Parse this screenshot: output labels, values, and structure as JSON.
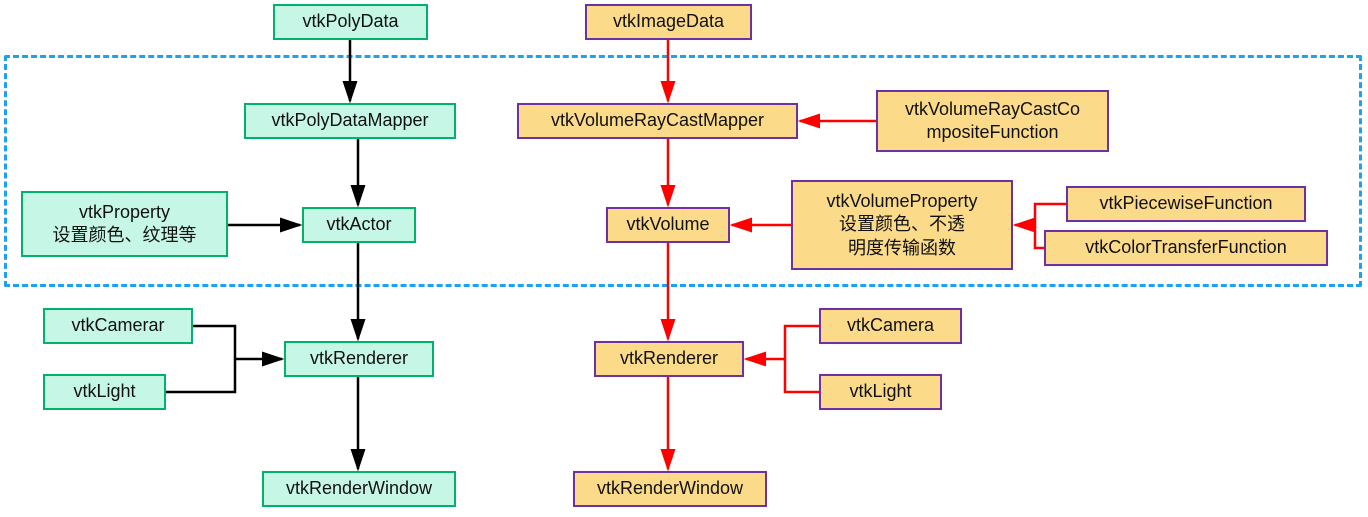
{
  "left": {
    "polyData": "vtkPolyData",
    "polyDataMapper": "vtkPolyDataMapper",
    "actor": "vtkActor",
    "property": "vtkProperty\n设置颜色、纹理等",
    "renderer": "vtkRenderer",
    "camera": "vtkCamerar",
    "light": "vtkLight",
    "renderWindow": "vtkRenderWindow"
  },
  "right": {
    "imageData": "vtkImageData",
    "rayCastMapper": "vtkVolumeRayCastMapper",
    "rayCastComposite": "vtkVolumeRayCastCo\nmpositeFunction",
    "volume": "vtkVolume",
    "volumeProperty": "vtkVolumeProperty\n设置颜色、不透\n明度传输函数",
    "piecewise": "vtkPiecewiseFunction",
    "colorTransfer": "vtkColorTransferFunction",
    "renderer": "vtkRenderer",
    "camera": "vtkCamera",
    "light": "vtkLight",
    "renderWindow": "vtkRenderWindow"
  },
  "colors": {
    "leftArrow": "#000000",
    "rightArrow": "#ff0000",
    "dashBorder": "#1da1f2",
    "leftBoxFill": "#c6f7e6",
    "leftBoxBorder": "#01b26c",
    "rightBoxFill": "#fbdb8a",
    "rightBoxBorder": "#7030a0"
  }
}
